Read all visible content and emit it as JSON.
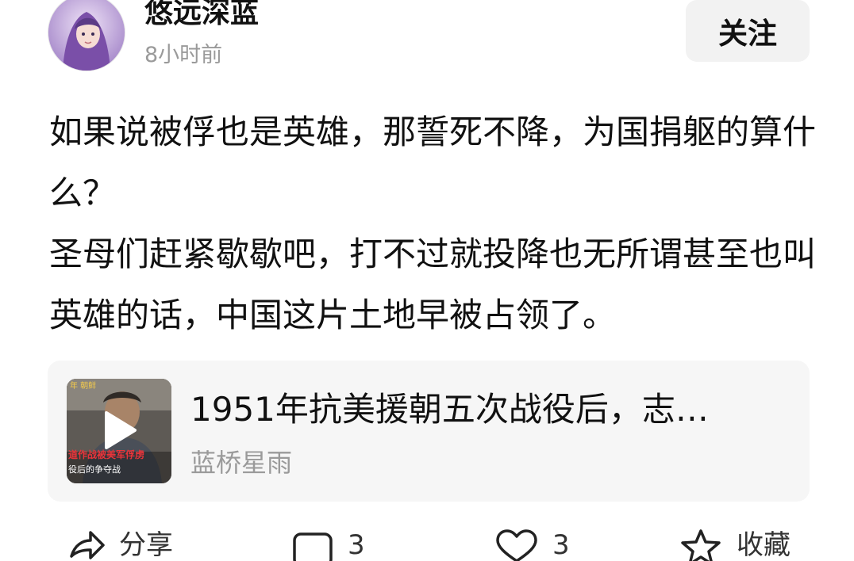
{
  "header": {
    "username": "悠远深蓝",
    "timestamp": "8小时前",
    "follow_label": "关注"
  },
  "post": {
    "paragraphs": [
      "如果说被俘也是英雄，那誓死不降，为国捐躯的算什么？",
      "圣母们赶紧歇歇吧，打不过就投降也无所谓甚至也叫英雄的话，中国这片土地早被占领了。"
    ]
  },
  "link_card": {
    "title": "1951年抗美援朝五次战役后，志…",
    "source": "蓝桥星雨",
    "thumbnail_caption_top": "年 朝鲜",
    "thumbnail_caption_main": "道作战被美军俘虏",
    "thumbnail_caption_sub": "役后的争夺战"
  },
  "actions": {
    "share_label": "分享",
    "comment_count": "3",
    "like_count": "3",
    "favorite_label": "收藏"
  },
  "icons": {
    "share": "share-icon",
    "comment": "comment-icon",
    "like": "heart-icon",
    "favorite": "star-icon",
    "play": "play-icon"
  },
  "colors": {
    "text_primary": "#111111",
    "text_secondary": "#9a9a9a",
    "card_bg": "#f6f6f6",
    "button_bg": "#f2f2f2"
  }
}
